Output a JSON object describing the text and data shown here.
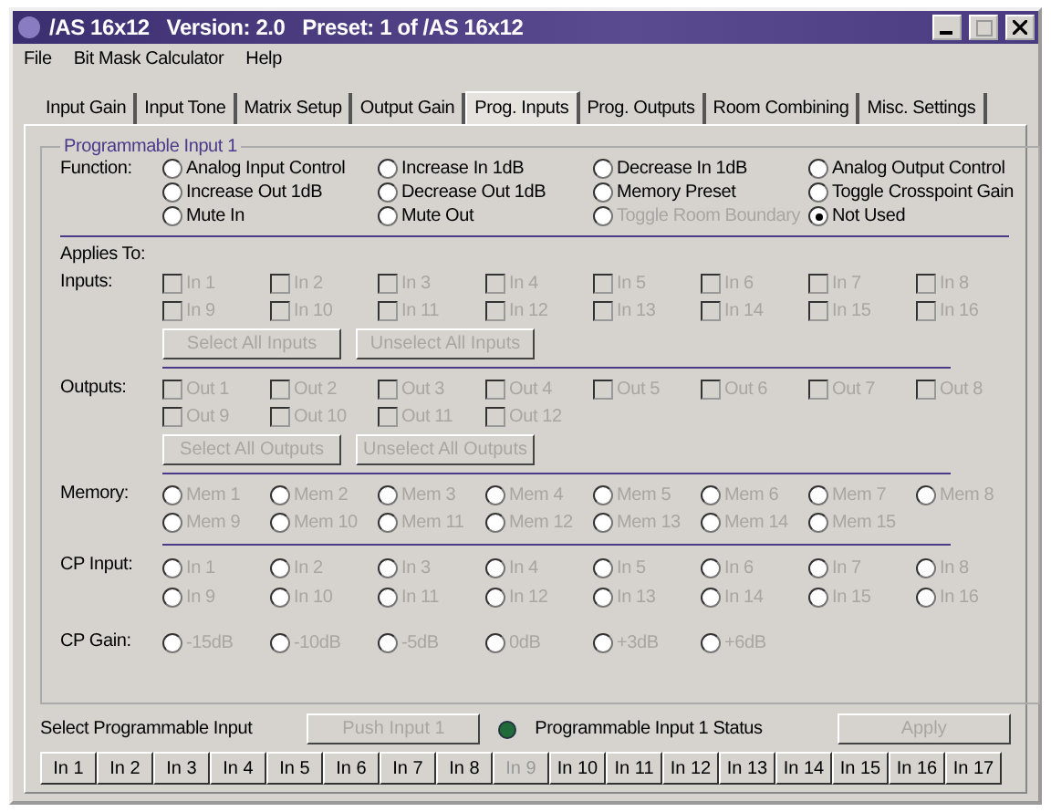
{
  "window": {
    "title": "/AS 16x12   Version: 2.0   Preset: 1 of /AS 16x12"
  },
  "menu": [
    "File",
    "Bit Mask Calculator",
    "Help"
  ],
  "tabs": [
    {
      "label": "Input Gain",
      "selected": false
    },
    {
      "label": "Input Tone",
      "selected": false
    },
    {
      "label": "Matrix Setup",
      "selected": false
    },
    {
      "label": "Output Gain",
      "selected": false
    },
    {
      "label": "Prog. Inputs",
      "selected": true
    },
    {
      "label": "Prog. Outputs",
      "selected": false
    },
    {
      "label": "Room Combining",
      "selected": false
    },
    {
      "label": "Misc. Settings",
      "selected": false
    }
  ],
  "group": {
    "title": "Programmable Input 1",
    "function": {
      "label": "Function:",
      "options": [
        {
          "label": "Analog Input Control",
          "selected": false,
          "disabled": false
        },
        {
          "label": "Increase In 1dB",
          "selected": false,
          "disabled": false
        },
        {
          "label": "Decrease In 1dB",
          "selected": false,
          "disabled": false
        },
        {
          "label": "Analog Output Control",
          "selected": false,
          "disabled": false
        },
        {
          "label": "Increase Out 1dB",
          "selected": false,
          "disabled": false
        },
        {
          "label": "Decrease Out 1dB",
          "selected": false,
          "disabled": false
        },
        {
          "label": "Memory Preset",
          "selected": false,
          "disabled": false
        },
        {
          "label": "Toggle Crosspoint Gain",
          "selected": false,
          "disabled": false
        },
        {
          "label": "Mute In",
          "selected": false,
          "disabled": false
        },
        {
          "label": "Mute Out",
          "selected": false,
          "disabled": false
        },
        {
          "label": "Toggle Room Boundary",
          "selected": false,
          "disabled": true
        },
        {
          "label": "Not Used",
          "selected": true,
          "disabled": false
        }
      ]
    },
    "applies_to": "Applies To:",
    "inputs": {
      "label": "Inputs:",
      "disabled": true,
      "items": [
        {
          "label": "In 1",
          "checked": false
        },
        {
          "label": "In 2",
          "checked": false
        },
        {
          "label": "In 3",
          "checked": false
        },
        {
          "label": "In 4",
          "checked": false
        },
        {
          "label": "In 5",
          "checked": false
        },
        {
          "label": "In 6",
          "checked": false
        },
        {
          "label": "In 7",
          "checked": false
        },
        {
          "label": "In 8",
          "checked": false
        },
        {
          "label": "In 9",
          "checked": false
        },
        {
          "label": "In 10",
          "checked": false
        },
        {
          "label": "In 11",
          "checked": false
        },
        {
          "label": "In 12",
          "checked": false
        },
        {
          "label": "In 13",
          "checked": false
        },
        {
          "label": "In 14",
          "checked": false
        },
        {
          "label": "In 15",
          "checked": false
        },
        {
          "label": "In 16",
          "checked": false
        }
      ],
      "buttons": [
        {
          "label": "Select All Inputs",
          "disabled": true
        },
        {
          "label": "Unselect All Inputs",
          "disabled": true
        }
      ]
    },
    "outputs": {
      "label": "Outputs:",
      "disabled": true,
      "items": [
        {
          "label": "Out 1",
          "checked": false
        },
        {
          "label": "Out 2",
          "checked": false
        },
        {
          "label": "Out 3",
          "checked": false
        },
        {
          "label": "Out 4",
          "checked": false
        },
        {
          "label": "Out 5",
          "checked": false
        },
        {
          "label": "Out 6",
          "checked": false
        },
        {
          "label": "Out 7",
          "checked": false
        },
        {
          "label": "Out 8",
          "checked": false
        },
        {
          "label": "Out 9",
          "checked": false
        },
        {
          "label": "Out 10",
          "checked": false
        },
        {
          "label": "Out 11",
          "checked": false
        },
        {
          "label": "Out 12",
          "checked": false
        }
      ],
      "buttons": [
        {
          "label": "Select All Outputs",
          "disabled": true
        },
        {
          "label": "Unselect All Outputs",
          "disabled": true
        }
      ]
    },
    "memory": {
      "label": "Memory:",
      "disabled": true,
      "items": [
        {
          "label": "Mem 1",
          "selected": false
        },
        {
          "label": "Mem 2",
          "selected": false
        },
        {
          "label": "Mem 3",
          "selected": false
        },
        {
          "label": "Mem 4",
          "selected": false
        },
        {
          "label": "Mem 5",
          "selected": false
        },
        {
          "label": "Mem 6",
          "selected": false
        },
        {
          "label": "Mem 7",
          "selected": false
        },
        {
          "label": "Mem 8",
          "selected": false
        },
        {
          "label": "Mem 9",
          "selected": false
        },
        {
          "label": "Mem 10",
          "selected": false
        },
        {
          "label": "Mem 11",
          "selected": false
        },
        {
          "label": "Mem 12",
          "selected": false
        },
        {
          "label": "Mem 13",
          "selected": false
        },
        {
          "label": "Mem 14",
          "selected": false
        },
        {
          "label": "Mem 15",
          "selected": false
        }
      ]
    },
    "cp_input": {
      "label": "CP Input:",
      "disabled": true,
      "items": [
        {
          "label": "In 1",
          "selected": false
        },
        {
          "label": "In 2",
          "selected": false
        },
        {
          "label": "In 3",
          "selected": false
        },
        {
          "label": "In 4",
          "selected": false
        },
        {
          "label": "In 5",
          "selected": false
        },
        {
          "label": "In 6",
          "selected": false
        },
        {
          "label": "In 7",
          "selected": false
        },
        {
          "label": "In 8",
          "selected": false
        },
        {
          "label": "In 9",
          "selected": false
        },
        {
          "label": "In 10",
          "selected": false
        },
        {
          "label": "In 11",
          "selected": false
        },
        {
          "label": "In 12",
          "selected": false
        },
        {
          "label": "In 13",
          "selected": false
        },
        {
          "label": "In 14",
          "selected": false
        },
        {
          "label": "In 15",
          "selected": false
        },
        {
          "label": "In 16",
          "selected": false
        }
      ]
    },
    "cp_gain": {
      "label": "CP Gain:",
      "disabled": true,
      "items": [
        {
          "label": "-15dB",
          "selected": false
        },
        {
          "label": "-10dB",
          "selected": false
        },
        {
          "label": "-5dB",
          "selected": false
        },
        {
          "label": "0dB",
          "selected": false
        },
        {
          "label": "+3dB",
          "selected": false
        },
        {
          "label": "+6dB",
          "selected": false
        }
      ]
    }
  },
  "footer": {
    "select_label": "Select Programmable Input",
    "push_button": {
      "label": "Push Input 1",
      "disabled": true
    },
    "status": {
      "label": "Programmable Input 1 Status",
      "on": true
    },
    "apply_button": {
      "label": "Apply",
      "disabled": true
    }
  },
  "input_tabs": [
    {
      "label": "In 1",
      "disabled": false
    },
    {
      "label": "In 2",
      "disabled": false
    },
    {
      "label": "In 3",
      "disabled": false
    },
    {
      "label": "In 4",
      "disabled": false
    },
    {
      "label": "In 5",
      "disabled": false
    },
    {
      "label": "In 6",
      "disabled": false
    },
    {
      "label": "In 7",
      "disabled": false
    },
    {
      "label": "In 8",
      "disabled": false
    },
    {
      "label": "In 9",
      "disabled": true
    },
    {
      "label": "In 10",
      "disabled": false
    },
    {
      "label": "In 11",
      "disabled": false
    },
    {
      "label": "In 12",
      "disabled": false
    },
    {
      "label": "In 13",
      "disabled": false
    },
    {
      "label": "In 14",
      "disabled": false
    },
    {
      "label": "In 15",
      "disabled": false
    },
    {
      "label": "In 16",
      "disabled": false
    },
    {
      "label": "In 17",
      "disabled": false
    }
  ]
}
